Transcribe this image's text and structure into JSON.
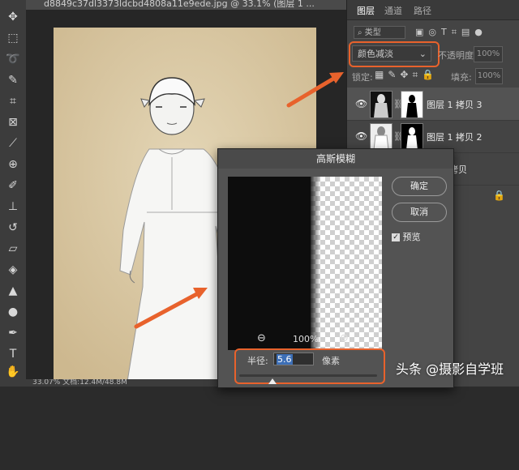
{
  "document": {
    "tab_title": "d8849c37dl3373ldcbd4808a11e9ede.jpg @ 33.1% (图层 1 ...",
    "status": "33.07%     文档:12.4M/48.8M"
  },
  "panel": {
    "tabs": [
      "图层",
      "通道",
      "路径"
    ],
    "filter_kind": "类型",
    "blend_mode": "颜色减淡",
    "opacity_label": "不透明度:",
    "opacity_value": "100%",
    "lock_label": "锁定:",
    "fill_label": "填充:",
    "fill_value": "100%",
    "layers": [
      {
        "name": "图层 1 拷贝 3"
      },
      {
        "name": "图层 1 拷贝 2"
      },
      {
        "name": "拷贝"
      }
    ]
  },
  "dialog": {
    "title": "高斯模糊",
    "ok_label": "确定",
    "cancel_label": "取消",
    "preview_label": "预览",
    "zoom_value": "100%",
    "radius_label": "半径:",
    "radius_value": "5.6",
    "radius_unit": "像素"
  },
  "watermark": "头条 @摄影自学班",
  "colors": {
    "accent": "#e8622c",
    "paper": "#d9c9a7"
  }
}
